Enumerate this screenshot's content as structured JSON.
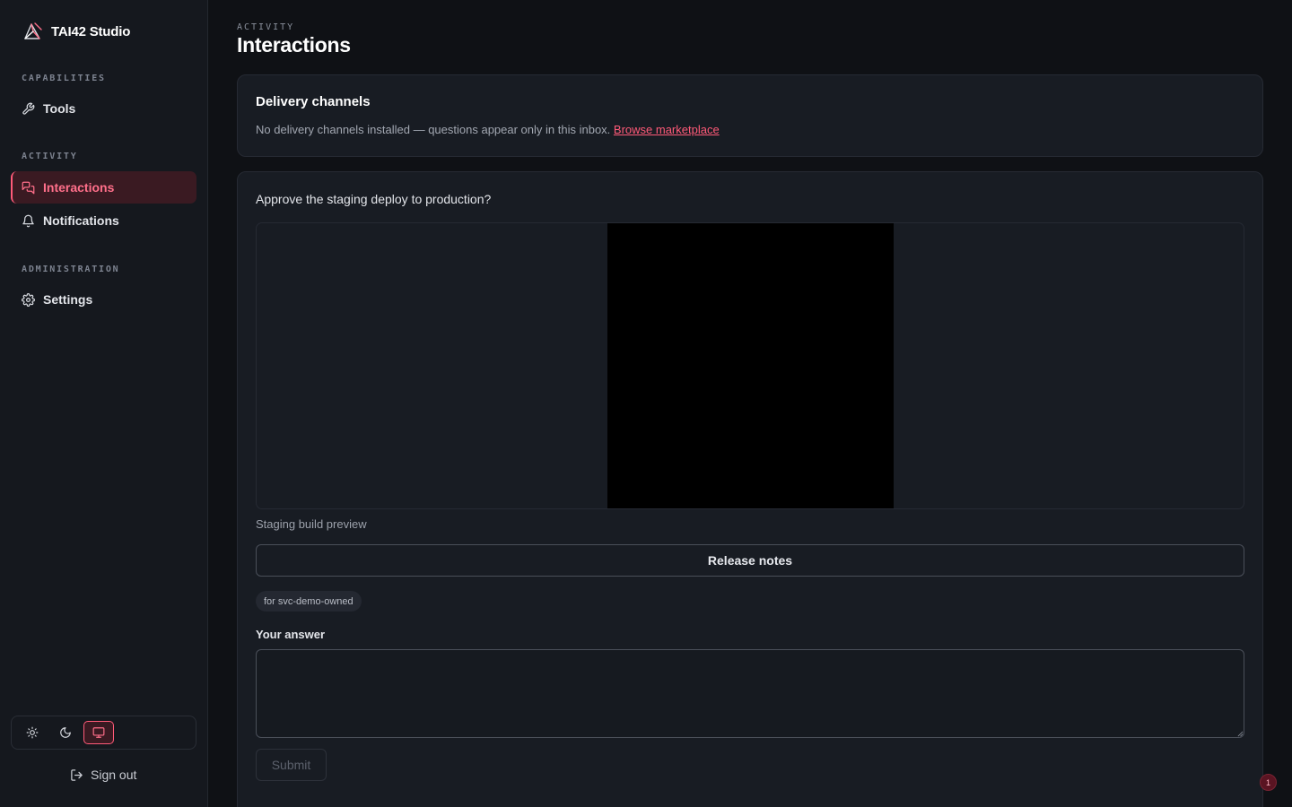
{
  "sidebar": {
    "brand": {
      "name": "TAI42 Studio",
      "icon": "tai42-logo-icon"
    },
    "sections": [
      {
        "label": "CAPABILITIES"
      },
      {
        "label": "ACTIVITY"
      },
      {
        "label": "ADMINISTRATION"
      }
    ],
    "items": [
      {
        "label": "Tools",
        "icon": "wrench-icon",
        "active": false
      },
      {
        "label": "Interactions",
        "icon": "chat-bubbles-icon",
        "active": true
      },
      {
        "label": "Notifications",
        "icon": "bell-icon",
        "active": false
      },
      {
        "label": "Settings",
        "icon": "gear-icon",
        "active": false
      }
    ],
    "theme": {
      "options": [
        "light",
        "dark",
        "system"
      ],
      "selected": "system"
    },
    "signout_label": "Sign out"
  },
  "header": {
    "eyebrow": "ACTIVITY",
    "title": "Interactions"
  },
  "delivery": {
    "title": "Delivery channels",
    "text": "No delivery channels installed — questions appear only in this inbox.",
    "link": "Browse marketplace"
  },
  "interaction": {
    "question": "Approve the staging deploy to production?",
    "caption": "Staging build preview",
    "release_notes_label": "Release notes",
    "owner_chip": "for svc-demo-owned",
    "answer_label": "Your answer",
    "answer_value": "",
    "submit_label": "Submit"
  },
  "notification_badge": {
    "count": "1"
  },
  "colors": {
    "accent": "#ff5a78",
    "background": "#0f1115",
    "sidebar": "#15181e",
    "card": "#181c23"
  }
}
